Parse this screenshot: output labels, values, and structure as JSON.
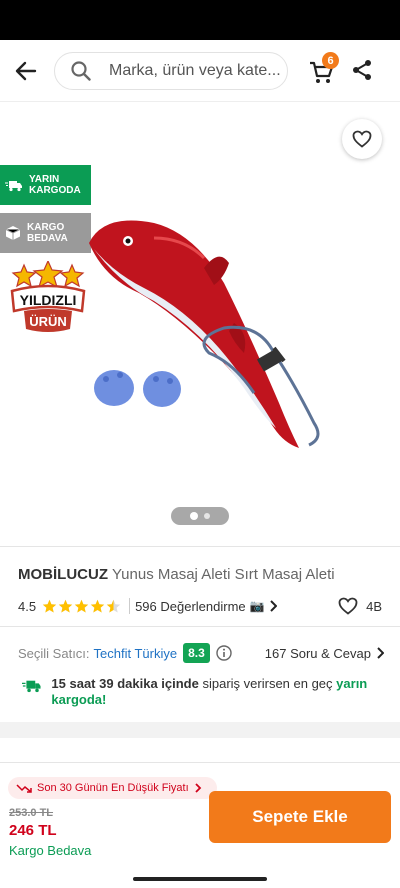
{
  "search": {
    "placeholder": "Marka, ürün veya kate..."
  },
  "cart": {
    "count": "6"
  },
  "badges": {
    "next_day": "YARIN KARGODA",
    "free_shipping": "KARGO BEDAVA",
    "seal_line1": "YILDIZLI",
    "seal_line2": "ÜRÜN"
  },
  "gallery": {
    "current_index": 1,
    "total": 2
  },
  "product": {
    "brand": "MOBİLUCUZ",
    "name": "Yunus Masaj Aleti Sırt Masaj Aleti",
    "rating": "4.5",
    "rating_value": 4.5,
    "review_count": "596 Değerlendirme",
    "camera_icon": "📷",
    "favorites": "4B"
  },
  "seller": {
    "label": "Seçili Satıcı:",
    "name": "Techfit Türkiye",
    "score": "8.3",
    "qa": "167 Soru & Cevap"
  },
  "shipping": {
    "time_bold": "15 saat 39 dakika içinde",
    "middle": "sipariş verirsen en geç",
    "tail": "yarın kargoda!"
  },
  "footer": {
    "lowest_price_label": "Son 30 Günün En Düşük Fiyatı",
    "old_price": "253.0 TL",
    "price": "246 TL",
    "free_shipping": "Kargo Bedava",
    "add_to_cart": "Sepete Ekle"
  },
  "colors": {
    "accent": "#f27a1a",
    "green": "#0b9c54",
    "link": "#1f72c4",
    "price_red": "#d0021b"
  }
}
